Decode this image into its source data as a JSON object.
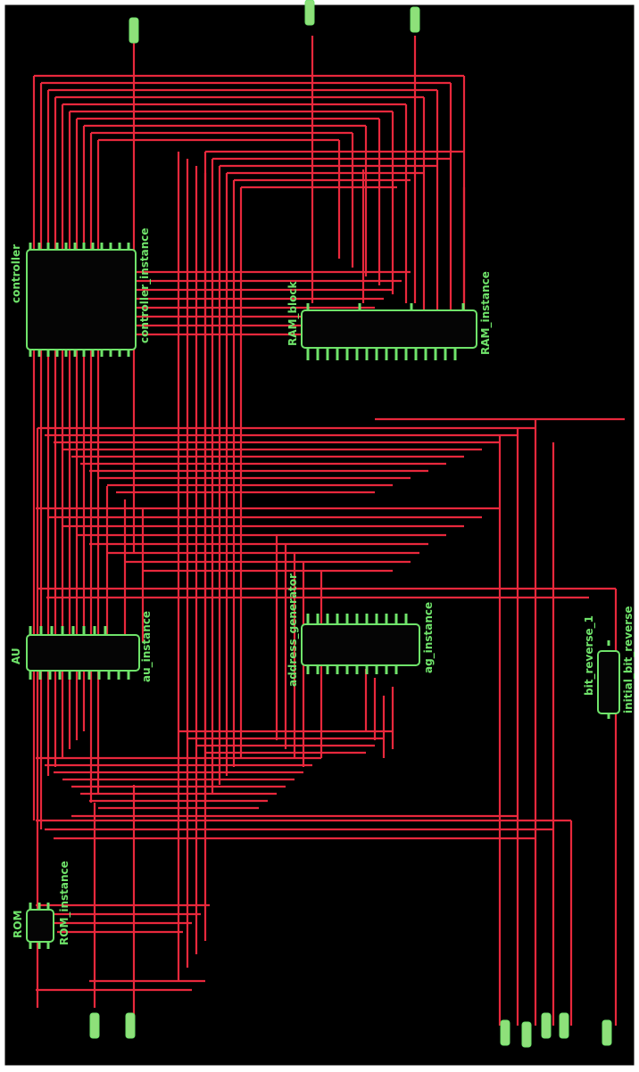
{
  "colors": {
    "background": "#000000",
    "frame": "#ffffff",
    "wire": "#e8283c",
    "block": "#6fe36a",
    "block_body": "#050505"
  },
  "blocks": {
    "controller": {
      "module": "controller",
      "instance": "controller_instance"
    },
    "ram": {
      "module": "RAM_block",
      "instance": "RAM_instance"
    },
    "au": {
      "module": "AU",
      "instance": "au_instance"
    },
    "ag": {
      "module": "address_generator",
      "instance": "ag_instance"
    },
    "bitrev": {
      "module": "bit_reverse_1",
      "instance": "initial_bit_reverse"
    },
    "rom": {
      "module": "ROM",
      "instance": "ROM_instance"
    }
  }
}
